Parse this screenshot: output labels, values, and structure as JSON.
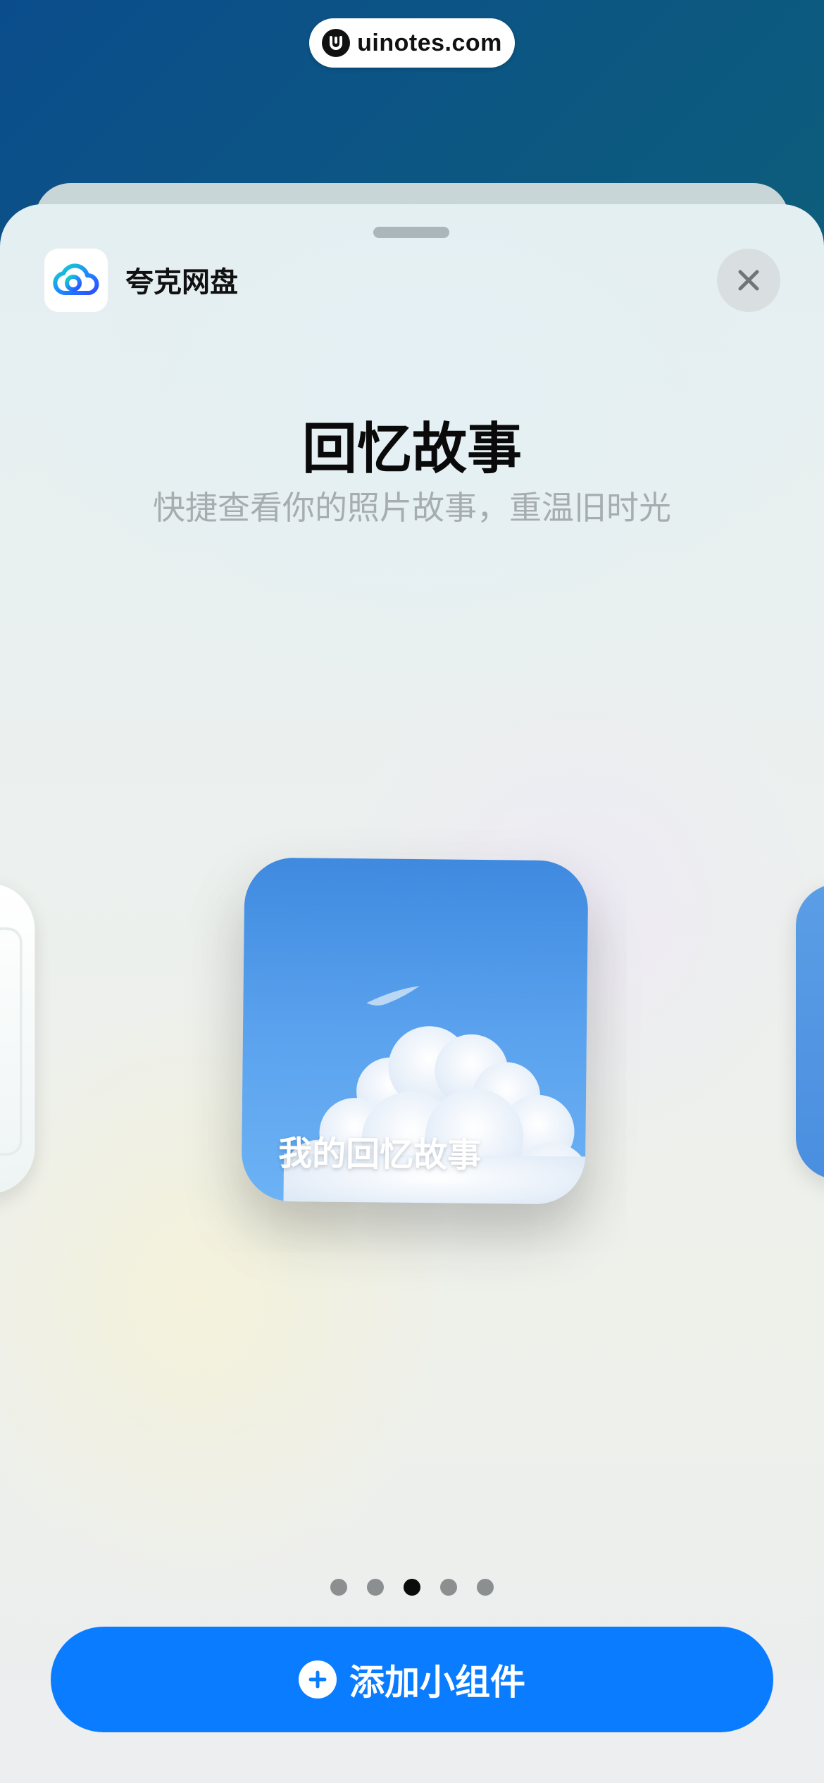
{
  "watermark": {
    "text": "uinotes.com"
  },
  "header": {
    "app_name": "夸克网盘",
    "app_icon": "quark-cloud-icon",
    "close_icon": "close-icon"
  },
  "widget_info": {
    "title": "回忆故事",
    "subtitle": "快捷查看你的照片故事，重温旧时光"
  },
  "widget_preview": {
    "label": "我的回忆故事",
    "background": "sky-with-cloud-photo"
  },
  "pagination": {
    "total": 5,
    "active_index": 2
  },
  "add_button": {
    "label": "添加小组件",
    "icon": "plus-circle-icon"
  },
  "colors": {
    "accent": "#0a7cff",
    "widget_sky": "#4a90e2"
  }
}
